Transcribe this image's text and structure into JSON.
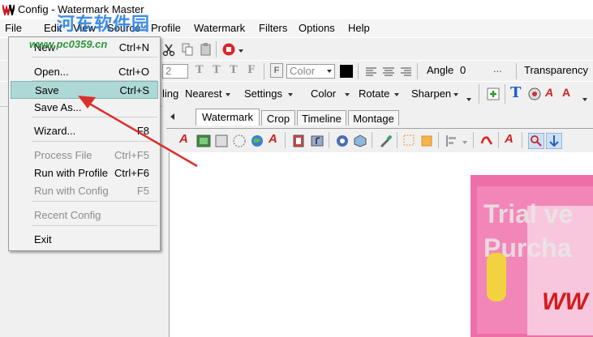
{
  "window": {
    "title": "Config - Watermark Master",
    "watermark_logo": "河东软件园",
    "watermark_url": "www.pc0359.cn"
  },
  "menubar": {
    "items": [
      {
        "label": "File",
        "key": "F"
      },
      {
        "label": "Edit",
        "key": "E"
      },
      {
        "label": "View",
        "key": "V"
      },
      {
        "label": "Source",
        "key": "S"
      },
      {
        "label": "Profile",
        "key": "P"
      },
      {
        "label": "Watermark",
        "key": "W"
      },
      {
        "label": "Filters",
        "key": "i"
      },
      {
        "label": "Options",
        "key": "O"
      },
      {
        "label": "Help",
        "key": "H"
      }
    ]
  },
  "file_menu": {
    "new": {
      "label": "New",
      "shortcut": "Ctrl+N"
    },
    "open": {
      "label": "Open...",
      "shortcut": "Ctrl+O"
    },
    "save": {
      "label": "Save",
      "shortcut": "Ctrl+S"
    },
    "save_as": {
      "label": "Save As..."
    },
    "wizard": {
      "label": "Wizard...",
      "shortcut": "F8"
    },
    "process_file": {
      "label": "Process File",
      "shortcut": "Ctrl+F5"
    },
    "run_with_profile": {
      "label": "Run with Profile",
      "shortcut": "Ctrl+F6"
    },
    "run_with_config": {
      "label": "Run with Config",
      "shortcut": "F5"
    },
    "recent_config": {
      "label": "Recent Config"
    },
    "exit": {
      "label": "Exit"
    }
  },
  "font_toolbar": {
    "size_value": "2",
    "color_value": "Color",
    "angle_label": "Angle",
    "angle_value": "0",
    "ellipsis": "...",
    "transparency_label": "Transparency"
  },
  "image_toolbar": {
    "resample_partial": "ling",
    "resample_value": "Nearest",
    "settings": "Settings",
    "color": "Color",
    "rotate": "Rotate",
    "sharpen": "Sharpen"
  },
  "tabs": {
    "watermark": "Watermark",
    "crop": "Crop",
    "timeline": "Timeline",
    "montage": "Montage"
  },
  "preview": {
    "line1": "Trial ve",
    "line2": "Purcha",
    "line3": "WW"
  },
  "colors": {
    "highlight": "#aed8d5",
    "arrow": "#d9302c",
    "preview_bg": "#ee6fa8"
  }
}
